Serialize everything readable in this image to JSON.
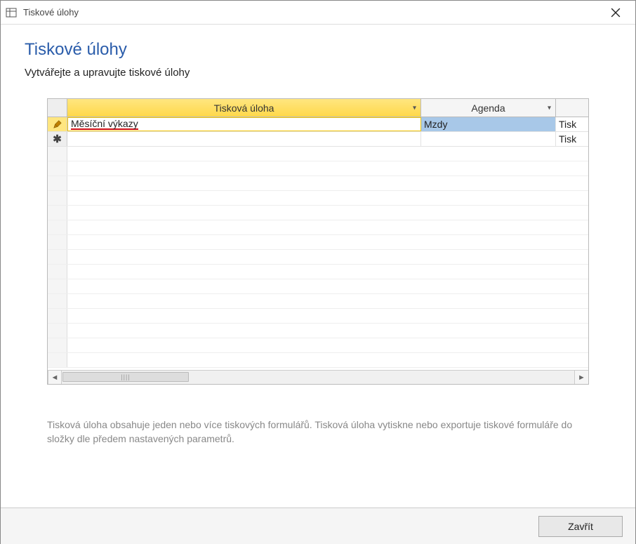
{
  "titlebar": {
    "title": "Tiskové úlohy"
  },
  "header": {
    "heading": "Tiskové úlohy",
    "subheading": "Vytvářejte a upravujte tiskové úlohy"
  },
  "grid": {
    "columns": {
      "col1": "Tisková úloha",
      "col2": "Agenda",
      "col3": ""
    },
    "rows": [
      {
        "state": "editing",
        "col1": "Měsíční výkazy",
        "col2": "Mzdy",
        "col3": "Tisk"
      },
      {
        "state": "new",
        "col1": "",
        "col2": "",
        "col3": "Tisk"
      }
    ]
  },
  "help": {
    "text": "Tisková úloha obsahuje jeden nebo více tiskových formulářů. Tisková úloha vytiskne nebo exportuje tiskové formuláře do složky dle předem nastavených parametrů."
  },
  "footer": {
    "close_label": "Zavřít"
  }
}
